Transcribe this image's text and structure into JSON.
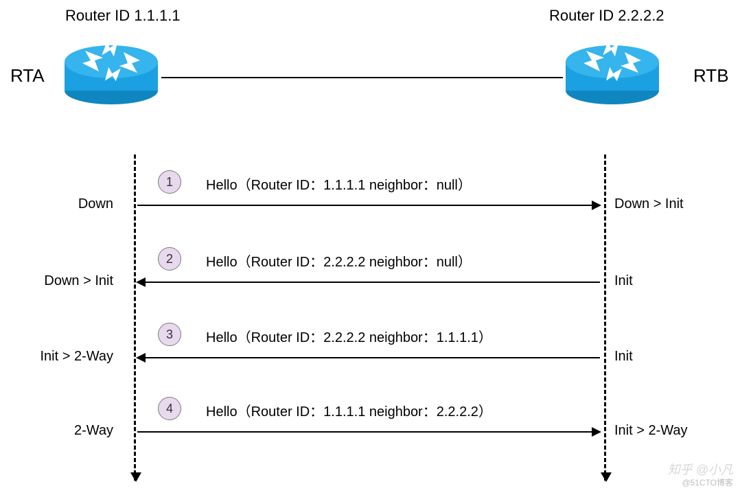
{
  "routers": {
    "a": {
      "id_label": "Router ID 1.1.1.1",
      "name": "RTA",
      "color": "#1ba1e2"
    },
    "b": {
      "id_label": "Router ID 2.2.2.2",
      "name": "RTB",
      "color": "#1ba1e2"
    }
  },
  "messages": [
    {
      "step": "1",
      "direction": "right",
      "text": "Hello（Router ID：1.1.1.1 neighbor：null）",
      "state_a": "Down",
      "state_b": "Down > Init"
    },
    {
      "step": "2",
      "direction": "left",
      "text": "Hello（Router ID：2.2.2.2 neighbor：null）",
      "state_a": "Down > Init",
      "state_b": "Init"
    },
    {
      "step": "3",
      "direction": "left",
      "text": "Hello（Router ID：2.2.2.2 neighbor：1.1.1.1）",
      "state_a": "Init > 2-Way",
      "state_b": "Init"
    },
    {
      "step": "4",
      "direction": "right",
      "text": "Hello（Router ID：1.1.1.1 neighbor：2.2.2.2）",
      "state_a": "2-Way",
      "state_b": "Init > 2-Way"
    }
  ],
  "watermark": {
    "line1": "知乎 @小凡",
    "line2": "@51CTO博客"
  }
}
